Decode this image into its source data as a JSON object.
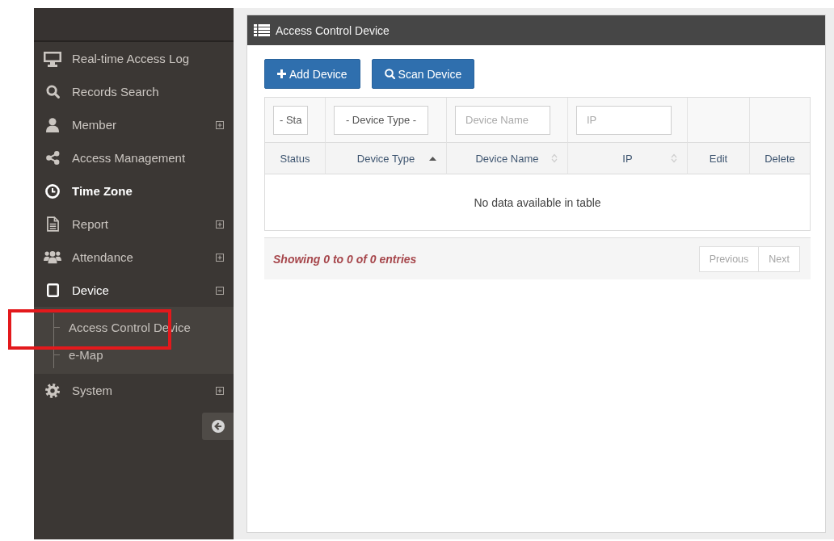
{
  "sidebar": {
    "items": [
      {
        "label": "Real-time Access Log",
        "kind": "link",
        "selected": false
      },
      {
        "label": "Records Search",
        "kind": "link",
        "selected": false
      },
      {
        "label": "Member",
        "kind": "group",
        "selected": false,
        "expanded": false
      },
      {
        "label": "Access Management",
        "kind": "link",
        "selected": false
      },
      {
        "label": "Time Zone",
        "kind": "link",
        "selected": true
      },
      {
        "label": "Report",
        "kind": "group",
        "selected": false,
        "expanded": false
      },
      {
        "label": "Attendance",
        "kind": "group",
        "selected": false,
        "expanded": false
      },
      {
        "label": "Device",
        "kind": "group",
        "selected": false,
        "expanded": true,
        "children": [
          {
            "label": "Access Control Device",
            "highlighted": true
          },
          {
            "label": "e-Map",
            "highlighted": false
          }
        ]
      },
      {
        "label": "System",
        "kind": "group",
        "selected": false,
        "expanded": false
      }
    ]
  },
  "panel": {
    "title": "Access Control Device",
    "buttons": [
      "Add Device",
      "Scan Device"
    ],
    "table": {
      "columns": [
        {
          "label": "Status",
          "sortable": false,
          "sorted": false,
          "filter": {
            "kind": "select",
            "value": "- Sta"
          }
        },
        {
          "label": "Device Type",
          "sortable": true,
          "sorted": true,
          "filter": {
            "kind": "select",
            "value": "- Device Type -"
          }
        },
        {
          "label": "Device Name",
          "sortable": true,
          "sorted": false,
          "filter": {
            "kind": "input",
            "placeholder": "Device Name"
          }
        },
        {
          "label": "IP",
          "sortable": true,
          "sorted": false,
          "filter": {
            "kind": "input",
            "placeholder": "IP"
          }
        },
        {
          "label": "Edit",
          "sortable": false,
          "sorted": false
        },
        {
          "label": "Delete",
          "sortable": false,
          "sorted": false
        }
      ],
      "empty_message": "No data available in table"
    },
    "footer": {
      "info": "Showing 0 to 0 of 0 entries",
      "pagination": [
        {
          "label": "Previous",
          "disabled": true
        },
        {
          "label": "Next",
          "disabled": true
        }
      ]
    }
  }
}
